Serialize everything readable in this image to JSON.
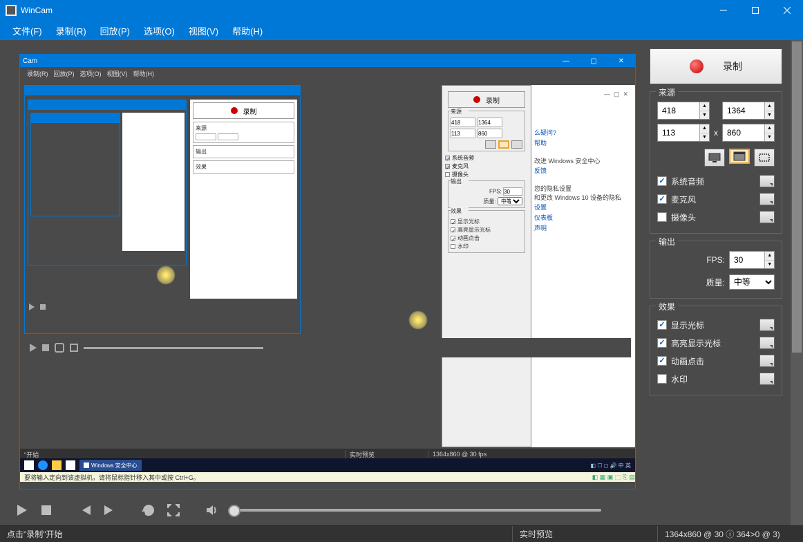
{
  "window": {
    "title": "WinCam"
  },
  "menu": {
    "file": "文件(F)",
    "record": "录制(R)",
    "playback": "回放(P)",
    "options": "选项(O)",
    "view": "视图(V)",
    "help": "帮助(H)"
  },
  "record_button": "录制",
  "source": {
    "title": "来源",
    "x": "418",
    "y": "113",
    "w": "1364",
    "h": "860",
    "xlabel": "x",
    "checks": {
      "system_audio": "系统音频",
      "microphone": "麦克风",
      "camera": "摄像头"
    }
  },
  "output": {
    "title": "输出",
    "fps_label": "FPS:",
    "fps_value": "30",
    "quality_label": "质量:",
    "quality_value": "中等"
  },
  "effects": {
    "title": "效果",
    "show_cursor": "显示光标",
    "highlight_cursor": "高亮显示光标",
    "animate_clicks": "动画点击",
    "watermark": "水印"
  },
  "status": {
    "left": "点击\"录制\"开始",
    "center": "实时预览",
    "right": "1364x860 @ 30 ⓘ 364>0 @ 3)"
  },
  "preview": {
    "inner_title": "Cam",
    "inner_menu": [
      "录制(R)",
      "回放(P)",
      "选项(O)",
      "视图(V)",
      "帮助(H)"
    ],
    "inner_rec": "录制",
    "inner_src": "来源",
    "inner_out": "输出",
    "inner_fx": "效果",
    "inner_fps": "FPS:",
    "inner_fps_v": "30",
    "inner_q": "质量:",
    "inner_q_v": "中等",
    "inner_sa": "系统音频",
    "inner_mic": "麦克风",
    "inner_cam": "摄像头",
    "inner_sc": "显示光标",
    "inner_hc": "高亮显示光标",
    "inner_ac": "动画点击",
    "inner_wm": "水印",
    "inner_x": "418",
    "inner_y": "113",
    "inner_w": "1364",
    "inner_h": "860",
    "inner_stat": "1364x860 @ 30 fps",
    "inner_rt": "实时预览",
    "inner_start": "\"开始",
    "win_sec": "Windows 安全中心",
    "link1": "么疑问?",
    "link2": "帮助",
    "link3": "改进 Windows 安全中心",
    "link4": "反馈",
    "link5": "您的隐私设置",
    "link6": "和更改 Windows 10 设备的隐私",
    "link7": "设置",
    "link8": "仪表板",
    "link9": "声明",
    "hint": "要将输入定向到该虚拟机，请将鼠标指针移入其中或按 Ctrl+G。"
  }
}
